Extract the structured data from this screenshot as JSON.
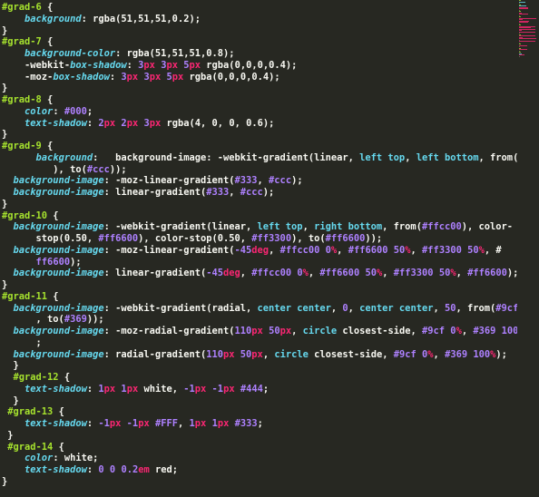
{
  "lines": [
    [
      [
        "sel",
        "#grad-6"
      ],
      [
        "plain",
        " {"
      ]
    ],
    [
      [
        "plain",
        "    "
      ],
      [
        "prop",
        "background"
      ],
      [
        "plain",
        ": rgba(51,51,51,0.2);"
      ]
    ],
    [
      [
        "plain",
        "}"
      ]
    ],
    [
      [
        "sel",
        "#grad-7"
      ],
      [
        "plain",
        " {"
      ]
    ],
    [
      [
        "plain",
        "    "
      ],
      [
        "prop",
        "background-color"
      ],
      [
        "plain",
        ": rgba(51,51,51,0.8);"
      ]
    ],
    [
      [
        "plain",
        "    -webkit-"
      ],
      [
        "prop",
        "box-shadow"
      ],
      [
        "plain",
        ": "
      ],
      [
        "num",
        "3"
      ],
      [
        "unit",
        "px"
      ],
      [
        "plain",
        " "
      ],
      [
        "num",
        "3"
      ],
      [
        "unit",
        "px"
      ],
      [
        "plain",
        " "
      ],
      [
        "num",
        "5"
      ],
      [
        "unit",
        "px"
      ],
      [
        "plain",
        " rgba(0,0,0,0.4);"
      ]
    ],
    [
      [
        "plain",
        "    -moz-"
      ],
      [
        "prop",
        "box-shadow"
      ],
      [
        "plain",
        ": "
      ],
      [
        "num",
        "3"
      ],
      [
        "unit",
        "px"
      ],
      [
        "plain",
        " "
      ],
      [
        "num",
        "3"
      ],
      [
        "unit",
        "px"
      ],
      [
        "plain",
        " "
      ],
      [
        "num",
        "5"
      ],
      [
        "unit",
        "px"
      ],
      [
        "plain",
        " rgba(0,0,0,0.4);"
      ]
    ],
    [
      [
        "plain",
        "}"
      ]
    ],
    [
      [
        "sel",
        "#grad-8"
      ],
      [
        "plain",
        " {"
      ]
    ],
    [
      [
        "plain",
        "    "
      ],
      [
        "prop",
        "color"
      ],
      [
        "plain",
        ": "
      ],
      [
        "num",
        "#000"
      ],
      [
        "plain",
        ";"
      ]
    ],
    [
      [
        "plain",
        "    "
      ],
      [
        "prop",
        "text-shadow"
      ],
      [
        "plain",
        ": "
      ],
      [
        "num",
        "2"
      ],
      [
        "unit",
        "px"
      ],
      [
        "plain",
        " "
      ],
      [
        "num",
        "2"
      ],
      [
        "unit",
        "px"
      ],
      [
        "plain",
        " "
      ],
      [
        "num",
        "3"
      ],
      [
        "unit",
        "px"
      ],
      [
        "plain",
        " rgba(4, 0, 0, 0.6);"
      ]
    ],
    [
      [
        "plain",
        "}"
      ]
    ],
    [
      [
        "sel",
        "#grad-9"
      ],
      [
        "plain",
        " {"
      ]
    ],
    [
      [
        "plain",
        "      "
      ],
      [
        "prop",
        "background"
      ],
      [
        "plain",
        ":   background-image: -webkit-gradient(linear, "
      ],
      [
        "kw",
        "left top"
      ],
      [
        "plain",
        ", "
      ],
      [
        "kw",
        "left bottom"
      ],
      [
        "plain",
        ", from("
      ],
      [
        "num",
        "#333"
      ]
    ],
    [
      [
        "plain",
        "         ), to("
      ],
      [
        "num",
        "#ccc"
      ],
      [
        "plain",
        "));"
      ]
    ],
    [
      [
        "plain",
        "  "
      ],
      [
        "prop",
        "background-image"
      ],
      [
        "plain",
        ": -moz-linear-gradient("
      ],
      [
        "num",
        "#333"
      ],
      [
        "plain",
        ", "
      ],
      [
        "num",
        "#ccc"
      ],
      [
        "plain",
        ");"
      ]
    ],
    [
      [
        "plain",
        "  "
      ],
      [
        "prop",
        "background-image"
      ],
      [
        "plain",
        ": linear-gradient("
      ],
      [
        "num",
        "#333"
      ],
      [
        "plain",
        ", "
      ],
      [
        "num",
        "#ccc"
      ],
      [
        "plain",
        ");"
      ]
    ],
    [
      [
        "plain",
        "}"
      ]
    ],
    [
      [
        "sel",
        "#grad-10"
      ],
      [
        "plain",
        " {"
      ]
    ],
    [
      [
        "plain",
        "  "
      ],
      [
        "prop",
        "background-image"
      ],
      [
        "plain",
        ": -webkit-gradient(linear, "
      ],
      [
        "kw",
        "left top"
      ],
      [
        "plain",
        ", "
      ],
      [
        "kw",
        "right bottom"
      ],
      [
        "plain",
        ", from("
      ],
      [
        "num",
        "#ffcc00"
      ],
      [
        "plain",
        "), color-"
      ]
    ],
    [
      [
        "plain",
        "      stop(0.50, "
      ],
      [
        "num",
        "#ff6600"
      ],
      [
        "plain",
        "), color-stop(0.50, "
      ],
      [
        "num",
        "#ff3300"
      ],
      [
        "plain",
        "), to("
      ],
      [
        "num",
        "#ff6600"
      ],
      [
        "plain",
        "));"
      ]
    ],
    [
      [
        "plain",
        "  "
      ],
      [
        "prop",
        "background-image"
      ],
      [
        "plain",
        ": -moz-linear-gradient("
      ],
      [
        "num",
        "-45"
      ],
      [
        "unit",
        "deg"
      ],
      [
        "plain",
        ", "
      ],
      [
        "num",
        "#ffcc00"
      ],
      [
        "plain",
        " "
      ],
      [
        "num",
        "0"
      ],
      [
        "pct",
        "%"
      ],
      [
        "plain",
        ", "
      ],
      [
        "num",
        "#ff6600"
      ],
      [
        "plain",
        " "
      ],
      [
        "num",
        "50"
      ],
      [
        "pct",
        "%"
      ],
      [
        "plain",
        ", "
      ],
      [
        "num",
        "#ff3300"
      ],
      [
        "plain",
        " "
      ],
      [
        "num",
        "50"
      ],
      [
        "pct",
        "%"
      ],
      [
        "plain",
        ", #"
      ]
    ],
    [
      [
        "plain",
        "      "
      ],
      [
        "num",
        "ff6600"
      ],
      [
        "plain",
        ");"
      ]
    ],
    [
      [
        "plain",
        "  "
      ],
      [
        "prop",
        "background-image"
      ],
      [
        "plain",
        ": linear-gradient("
      ],
      [
        "num",
        "-45"
      ],
      [
        "unit",
        "deg"
      ],
      [
        "plain",
        ", "
      ],
      [
        "num",
        "#ffcc00"
      ],
      [
        "plain",
        " "
      ],
      [
        "num",
        "0"
      ],
      [
        "pct",
        "%"
      ],
      [
        "plain",
        ", "
      ],
      [
        "num",
        "#ff6600"
      ],
      [
        "plain",
        " "
      ],
      [
        "num",
        "50"
      ],
      [
        "pct",
        "%"
      ],
      [
        "plain",
        ", "
      ],
      [
        "num",
        "#ff3300"
      ],
      [
        "plain",
        " "
      ],
      [
        "num",
        "50"
      ],
      [
        "pct",
        "%"
      ],
      [
        "plain",
        ", "
      ],
      [
        "num",
        "#ff6600"
      ],
      [
        "plain",
        ");"
      ]
    ],
    [
      [
        "plain",
        "}"
      ]
    ],
    [
      [
        "sel",
        "#grad-11"
      ],
      [
        "plain",
        " {"
      ]
    ],
    [
      [
        "plain",
        "  "
      ],
      [
        "prop",
        "background-image"
      ],
      [
        "plain",
        ": -webkit-gradient(radial, "
      ],
      [
        "kw",
        "center center"
      ],
      [
        "plain",
        ", "
      ],
      [
        "num",
        "0"
      ],
      [
        "plain",
        ", "
      ],
      [
        "kw",
        "center center"
      ],
      [
        "plain",
        ", "
      ],
      [
        "num",
        "50"
      ],
      [
        "plain",
        ", from("
      ],
      [
        "num",
        "#9cf"
      ],
      [
        "plain",
        ")"
      ]
    ],
    [
      [
        "plain",
        "      , to("
      ],
      [
        "num",
        "#369"
      ],
      [
        "plain",
        "));"
      ]
    ],
    [
      [
        "plain",
        "  "
      ],
      [
        "prop",
        "background-image"
      ],
      [
        "plain",
        ": -moz-radial-gradient("
      ],
      [
        "num",
        "110"
      ],
      [
        "unit",
        "px"
      ],
      [
        "plain",
        " "
      ],
      [
        "num",
        "50"
      ],
      [
        "unit",
        "px"
      ],
      [
        "plain",
        ", "
      ],
      [
        "kw",
        "circle"
      ],
      [
        "plain",
        " closest-side, "
      ],
      [
        "num",
        "#9cf"
      ],
      [
        "plain",
        " "
      ],
      [
        "num",
        "0"
      ],
      [
        "pct",
        "%"
      ],
      [
        "plain",
        ", "
      ],
      [
        "num",
        "#369"
      ],
      [
        "plain",
        " "
      ],
      [
        "num",
        "100"
      ],
      [
        "pct",
        "%"
      ],
      [
        "plain",
        ")"
      ]
    ],
    [
      [
        "plain",
        "      ;"
      ]
    ],
    [
      [
        "plain",
        "  "
      ],
      [
        "prop",
        "background-image"
      ],
      [
        "plain",
        ": radial-gradient("
      ],
      [
        "num",
        "110"
      ],
      [
        "unit",
        "px"
      ],
      [
        "plain",
        " "
      ],
      [
        "num",
        "50"
      ],
      [
        "unit",
        "px"
      ],
      [
        "plain",
        ", "
      ],
      [
        "kw",
        "circle"
      ],
      [
        "plain",
        " closest-side, "
      ],
      [
        "num",
        "#9cf"
      ],
      [
        "plain",
        " "
      ],
      [
        "num",
        "0"
      ],
      [
        "pct",
        "%"
      ],
      [
        "plain",
        ", "
      ],
      [
        "num",
        "#369"
      ],
      [
        "plain",
        " "
      ],
      [
        "num",
        "100"
      ],
      [
        "pct",
        "%"
      ],
      [
        "plain",
        ");"
      ]
    ],
    [
      [
        "plain",
        "  }"
      ]
    ],
    [
      [
        "plain",
        "  "
      ],
      [
        "sel",
        "#grad-12"
      ],
      [
        "plain",
        " {"
      ]
    ],
    [
      [
        "plain",
        "    "
      ],
      [
        "prop",
        "text-shadow"
      ],
      [
        "plain",
        ": "
      ],
      [
        "num",
        "1"
      ],
      [
        "unit",
        "px"
      ],
      [
        "plain",
        " "
      ],
      [
        "num",
        "1"
      ],
      [
        "unit",
        "px"
      ],
      [
        "plain",
        " white, "
      ],
      [
        "num",
        "-1"
      ],
      [
        "unit",
        "px"
      ],
      [
        "plain",
        " "
      ],
      [
        "num",
        "-1"
      ],
      [
        "unit",
        "px"
      ],
      [
        "plain",
        " "
      ],
      [
        "num",
        "#444"
      ],
      [
        "plain",
        ";"
      ]
    ],
    [
      [
        "plain",
        "  }"
      ]
    ],
    [
      [
        "plain",
        " "
      ],
      [
        "sel",
        "#grad-13"
      ],
      [
        "plain",
        " {"
      ]
    ],
    [
      [
        "plain",
        "    "
      ],
      [
        "prop",
        "text-shadow"
      ],
      [
        "plain",
        ": "
      ],
      [
        "num",
        "-1"
      ],
      [
        "unit",
        "px"
      ],
      [
        "plain",
        " "
      ],
      [
        "num",
        "-1"
      ],
      [
        "unit",
        "px"
      ],
      [
        "plain",
        " "
      ],
      [
        "num",
        "#FFF"
      ],
      [
        "plain",
        ", "
      ],
      [
        "num",
        "1"
      ],
      [
        "unit",
        "px"
      ],
      [
        "plain",
        " "
      ],
      [
        "num",
        "1"
      ],
      [
        "unit",
        "px"
      ],
      [
        "plain",
        " "
      ],
      [
        "num",
        "#333"
      ],
      [
        "plain",
        ";"
      ]
    ],
    [
      [
        "plain",
        " }"
      ]
    ],
    [
      [
        "plain",
        " "
      ],
      [
        "sel",
        "#grad-14"
      ],
      [
        "plain",
        " {"
      ]
    ],
    [
      [
        "plain",
        "    "
      ],
      [
        "prop",
        "color"
      ],
      [
        "plain",
        ": white;"
      ]
    ],
    [
      [
        "plain",
        "    "
      ],
      [
        "prop",
        "text-shadow"
      ],
      [
        "plain",
        ": "
      ],
      [
        "num",
        "0"
      ],
      [
        "plain",
        " "
      ],
      [
        "num",
        "0"
      ],
      [
        "plain",
        " "
      ],
      [
        "num",
        "0.2"
      ],
      [
        "unit",
        "em"
      ],
      [
        "plain",
        " red;"
      ]
    ],
    [
      [
        "plain",
        "}"
      ]
    ]
  ],
  "colors": {
    "background": "#272822",
    "selector": "#a6e22e",
    "property": "#66d9ef",
    "number": "#ae81ff",
    "unit": "#f92672",
    "text": "#f8f8f2"
  }
}
